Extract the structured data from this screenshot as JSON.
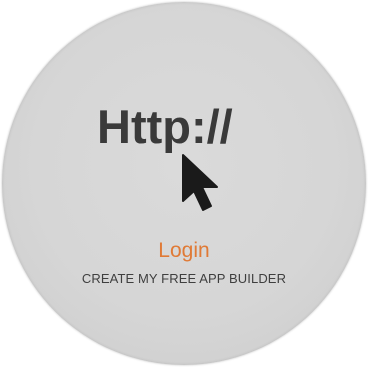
{
  "badge": {
    "http_label": "Http://",
    "cursor_icon": "mouse-pointer-arrow-icon",
    "colors": {
      "background": "#d6d6d6",
      "http_text": "#3a3a3a",
      "login": "#e07a36",
      "create": "#3f3f3f"
    }
  },
  "links": {
    "login_label": "Login",
    "create_label": "CREATE MY FREE APP BUILDER"
  }
}
